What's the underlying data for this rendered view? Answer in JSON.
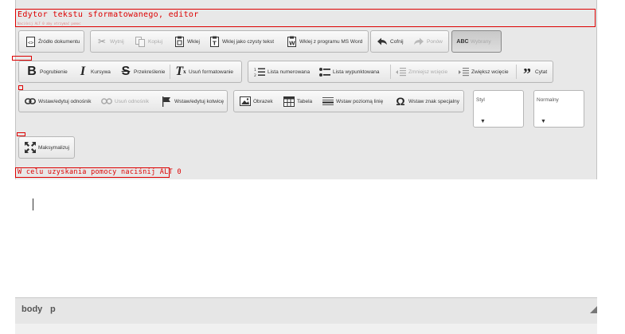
{
  "editor": {
    "title": "Edytor tekstu sformatowanego, editor",
    "subtitle": "Naciśnij ALT 0 aby otrzymać pomoc",
    "help_text": "W celu uzyskania pomocy naciśnij ALT 0"
  },
  "toolbar": {
    "row1": {
      "source": "Źródło dokumentu",
      "cut": "Wytnij",
      "copy": "Kopiuj",
      "paste": "Wklej",
      "paste_text": "Wklej jako czysty tekst",
      "paste_word": "Wklej z programu MS Word",
      "undo": "Cofnij",
      "redo": "Ponów",
      "spell": "Wybrany"
    },
    "row2": {
      "bold": "Pogrubienie",
      "italic": "Kursywa",
      "strike": "Przekreślenie",
      "remove_format": "Usuń formatowanie",
      "numbered_list": "Lista numerowana",
      "bulleted_list": "Lista wypunktowana",
      "outdent": "Zmniejsz wcięcie",
      "indent": "Zwiększ wcięcie",
      "blockquote": "Cytat"
    },
    "row3": {
      "link": "Wstaw/edytuj odnośnik",
      "unlink": "Usuń odnośnik",
      "anchor": "Wstaw/edytuj kotwicę",
      "image": "Obrazek",
      "table": "Tabela",
      "hr": "Wstaw poziomą linię",
      "special_char": "Wstaw znak specjalny",
      "styles": "Styl",
      "format": "Normalny"
    },
    "row4": {
      "maximize": "Maksymalizuj"
    }
  },
  "status": {
    "path": [
      "body",
      "p"
    ]
  },
  "icons": {
    "source": "document-source-icon",
    "cut": "scissors-icon",
    "copy": "copy-icon",
    "paste": "clipboard-icon",
    "bold": "bold-icon",
    "italic": "italic-icon"
  }
}
